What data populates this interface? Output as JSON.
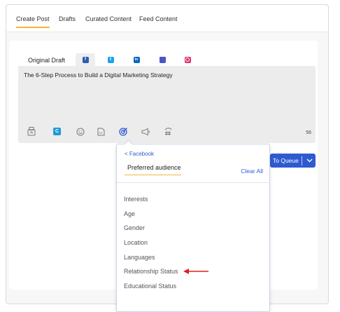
{
  "tabs": [
    "Create Post",
    "Drafts",
    "Curated Content",
    "Feed Content"
  ],
  "active_tab": "Create Post",
  "editor_tabs": {
    "original_draft": "Original Draft",
    "networks": [
      {
        "name": "facebook-icon",
        "glyph": "f",
        "color": "#2b5ab3",
        "selected": true
      },
      {
        "name": "twitter-icon",
        "glyph": "t",
        "color": "#1da1f2",
        "selected": false
      },
      {
        "name": "linkedin-icon",
        "glyph": "in",
        "color": "#0a66c2",
        "selected": false
      },
      {
        "name": "google-business-icon",
        "glyph": "",
        "color": "#4a55c7",
        "selected": false
      },
      {
        "name": "instagram-icon",
        "glyph": "",
        "color": "#e1306c",
        "selected": false
      }
    ]
  },
  "editor": {
    "text": "The 6-Step Process to Build a Digital Marketing Strategy",
    "char_count": "56"
  },
  "toolbar_icons": [
    "media-upload-icon",
    "canva-icon",
    "emoji-icon",
    "gif-icon",
    "targeting-icon",
    "megaphone-icon",
    "hashtag-icon"
  ],
  "queue_button": {
    "label": "To Queue",
    "chevron": "⌄"
  },
  "dropdown": {
    "back_label": "< Facebook",
    "field_value": "Preferred audience",
    "clear_label": "Clear All",
    "options": [
      "Interests",
      "Age",
      "Gender",
      "Location",
      "Languages",
      "Relationship Status",
      "Educational Status"
    ]
  },
  "colors": {
    "accent": "#f2b93b",
    "primary": "#2f5bd1",
    "annotation": "#e02020"
  }
}
